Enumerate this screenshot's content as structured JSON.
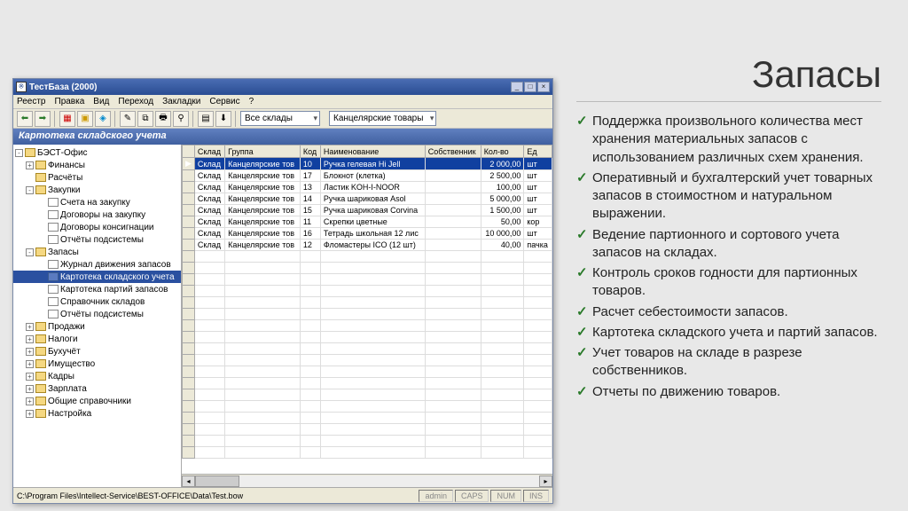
{
  "slide": {
    "heading": "Запасы",
    "bullets": [
      "Поддержка произвольного количества мест хранения материальных запасов с использованием различных схем хранения.",
      "Оперативный и бухгалтерский учет товарных запасов в стоимостном и натуральном выражении.",
      "Ведение партионного и сортового учета запасов на складах.",
      "Контроль сроков годности для партионных товаров.",
      "Расчет себестоимости запасов.",
      "Картотека складского учета и партий запасов.",
      "Учет товаров на складе в разрезе собственников.",
      "Отчеты по движению товаров."
    ]
  },
  "app": {
    "title": "ТестБаза (2000)",
    "menus": [
      "Реестр",
      "Правка",
      "Вид",
      "Переход",
      "Закладки",
      "Сервис",
      "?"
    ],
    "combo1": "Все склады",
    "combo2": "Канцелярские товары",
    "panel_title": "Картотека складского учета",
    "tree": [
      {
        "ind": 0,
        "exp": "-",
        "icon": "folder",
        "label": "БЭСТ-Офис"
      },
      {
        "ind": 1,
        "exp": "+",
        "icon": "folder",
        "label": "Финансы"
      },
      {
        "ind": 1,
        "exp": "",
        "icon": "folder",
        "label": "Расчёты"
      },
      {
        "ind": 1,
        "exp": "-",
        "icon": "folder",
        "label": "Закупки"
      },
      {
        "ind": 2,
        "exp": "",
        "icon": "page",
        "label": "Счета на закупку"
      },
      {
        "ind": 2,
        "exp": "",
        "icon": "page",
        "label": "Договоры на закупку"
      },
      {
        "ind": 2,
        "exp": "",
        "icon": "page",
        "label": "Договоры консигнации"
      },
      {
        "ind": 2,
        "exp": "",
        "icon": "page",
        "label": "Отчёты подсистемы"
      },
      {
        "ind": 1,
        "exp": "-",
        "icon": "folder",
        "label": "Запасы"
      },
      {
        "ind": 2,
        "exp": "",
        "icon": "page",
        "label": "Журнал движения запасов"
      },
      {
        "ind": 2,
        "exp": "",
        "icon": "sel",
        "label": "Картотека складского учета",
        "sel": true
      },
      {
        "ind": 2,
        "exp": "",
        "icon": "page",
        "label": "Картотека партий запасов"
      },
      {
        "ind": 2,
        "exp": "",
        "icon": "page",
        "label": "Справочник складов"
      },
      {
        "ind": 2,
        "exp": "",
        "icon": "page",
        "label": "Отчёты подсистемы"
      },
      {
        "ind": 1,
        "exp": "+",
        "icon": "folder",
        "label": "Продажи"
      },
      {
        "ind": 1,
        "exp": "+",
        "icon": "folder",
        "label": "Налоги"
      },
      {
        "ind": 1,
        "exp": "+",
        "icon": "folder",
        "label": "Бухучёт"
      },
      {
        "ind": 1,
        "exp": "+",
        "icon": "folder",
        "label": "Имущество"
      },
      {
        "ind": 1,
        "exp": "+",
        "icon": "folder",
        "label": "Кадры"
      },
      {
        "ind": 1,
        "exp": "+",
        "icon": "folder",
        "label": "Зарплата"
      },
      {
        "ind": 1,
        "exp": "+",
        "icon": "folder",
        "label": "Общие справочники"
      },
      {
        "ind": 1,
        "exp": "+",
        "icon": "folder",
        "label": "Настройка"
      }
    ],
    "columns": [
      "Склад",
      "Группа",
      "Код",
      "Наименование",
      "Собственник",
      "Кол-во",
      "Ед"
    ],
    "rows": [
      {
        "sel": true,
        "c": [
          "Склад",
          "Канцелярские тов",
          "10",
          "Ручка гелевая Hi Jell",
          "",
          "2 000,00",
          "шт"
        ]
      },
      {
        "c": [
          "Склад",
          "Канцелярские тов",
          "17",
          "Блокнот (клетка)",
          "",
          "2 500,00",
          "шт"
        ]
      },
      {
        "c": [
          "Склад",
          "Канцелярские тов",
          "13",
          "Ластик KOH-I-NOOR",
          "",
          "100,00",
          "шт"
        ]
      },
      {
        "c": [
          "Склад",
          "Канцелярские тов",
          "14",
          "Ручка шариковая Asol",
          "",
          "5 000,00",
          "шт"
        ]
      },
      {
        "c": [
          "Склад",
          "Канцелярские тов",
          "15",
          "Ручка шариковая Corvina",
          "",
          "1 500,00",
          "шт"
        ]
      },
      {
        "c": [
          "Склад",
          "Канцелярские тов",
          "11",
          "Скрепки цветные",
          "",
          "50,00",
          "кор"
        ]
      },
      {
        "c": [
          "Склад",
          "Канцелярские тов",
          "16",
          "Тетрадь школьная 12 лис",
          "",
          "10 000,00",
          "шт"
        ]
      },
      {
        "c": [
          "Склад",
          "Канцелярские тов",
          "12",
          "Фломастеры ICO (12 шт)",
          "",
          "40,00",
          "пачка"
        ]
      }
    ],
    "status_path": "C:\\Program Files\\Intellect-Service\\BEST-OFFICE\\Data\\Test.bow",
    "status_user": "admin",
    "status_ind": [
      "CAPS",
      "NUM",
      "INS"
    ]
  }
}
